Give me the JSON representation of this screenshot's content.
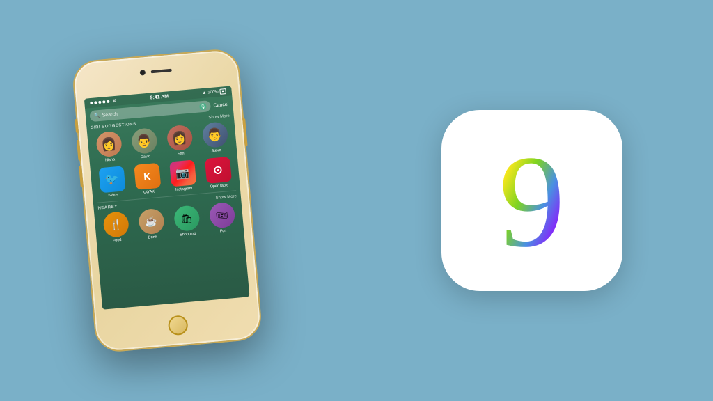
{
  "background_color": "#7ab0c8",
  "iphone": {
    "status_bar": {
      "dots": 5,
      "wifi": "WiFi",
      "time": "9:41 AM",
      "arrow": "▲",
      "battery": "100%"
    },
    "search": {
      "placeholder": "Search",
      "cancel_label": "Cancel"
    },
    "siri_section": {
      "title": "SIRI SUGGESTIONS",
      "show_more": "Show More",
      "contacts": [
        {
          "name": "Nisha",
          "color": "#d4956a"
        },
        {
          "name": "David",
          "color": "#8a9e7a"
        },
        {
          "name": "Erin",
          "color": "#c07060"
        },
        {
          "name": "Steve",
          "color": "#6080a0"
        }
      ],
      "apps": [
        {
          "name": "Twitter",
          "icon": "🐦",
          "bg": "#1da1f2"
        },
        {
          "name": "KAYAK",
          "icon": "K",
          "bg": "#f5891f"
        },
        {
          "name": "Instagram",
          "icon": "📷",
          "bg": "#e1306c"
        },
        {
          "name": "OpenTable",
          "icon": "⊙",
          "bg": "#dc143c"
        }
      ]
    },
    "nearby_section": {
      "title": "NEARBY",
      "show_more": "Show More",
      "items": [
        {
          "name": "Food",
          "icon": "🍴",
          "bg": "#e8920a"
        },
        {
          "name": "Drink",
          "icon": "☕",
          "bg": "#c8a068"
        },
        {
          "name": "Shopping",
          "icon": "🛍",
          "bg": "#3cb878"
        },
        {
          "name": "Fun",
          "icon": "🎟",
          "bg": "#9b59b6"
        }
      ]
    }
  },
  "ios9_logo": {
    "digit": "9",
    "colors": [
      "#f5a623",
      "#f8e71c",
      "#7ed321",
      "#4a90e2",
      "#9013fe",
      "#d0021b"
    ]
  }
}
